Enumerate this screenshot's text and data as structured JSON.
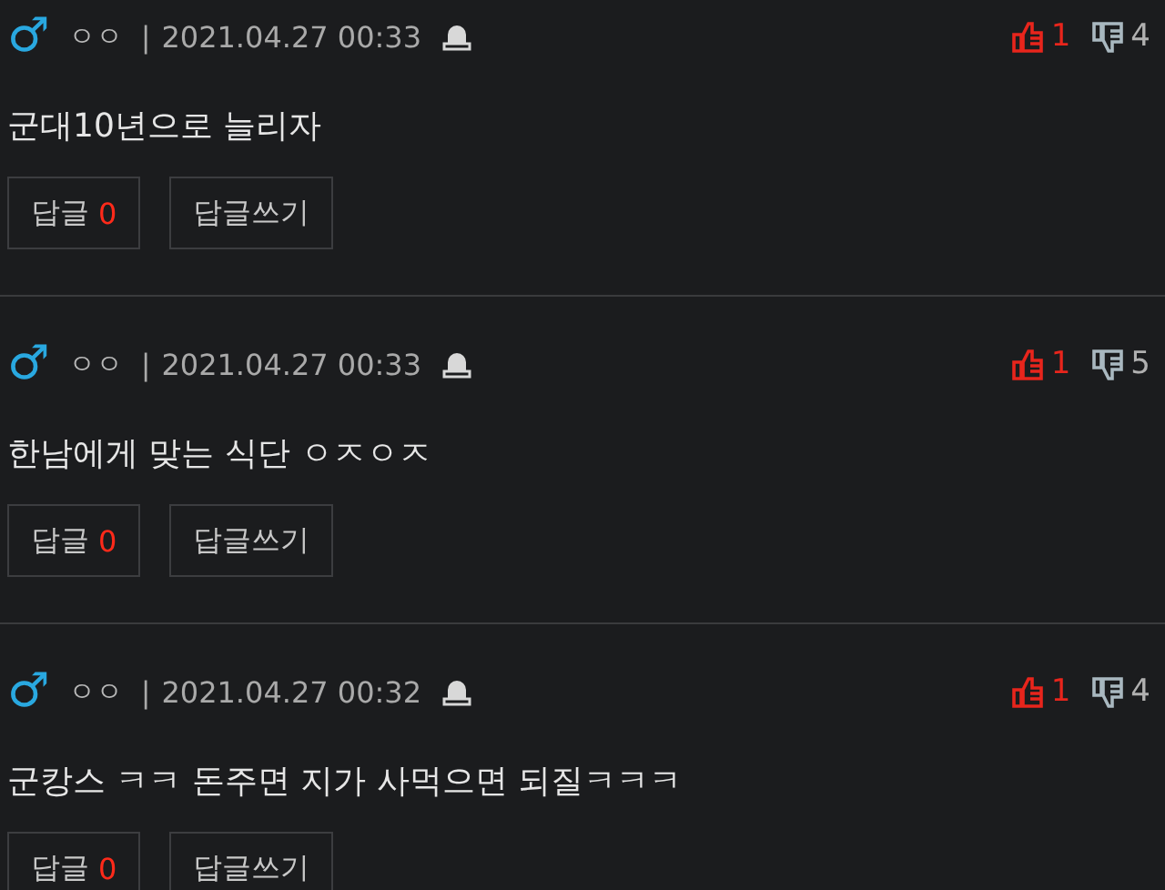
{
  "comments": [
    {
      "gender_symbol": "♂",
      "nickname": "ㅇㅇ",
      "separator": "|",
      "date": "2021.04.27 00:33",
      "likes": "1",
      "dislikes": "4",
      "text": "군대10년으로 늘리자",
      "reply_label": "답글",
      "reply_count": "0",
      "write_reply": "답글쓰기"
    },
    {
      "gender_symbol": "♂",
      "nickname": "ㅇㅇ",
      "separator": "|",
      "date": "2021.04.27 00:33",
      "likes": "1",
      "dislikes": "5",
      "text": "한남에게 맞는 식단 ㅇㅈㅇㅈ",
      "reply_label": "답글",
      "reply_count": "0",
      "write_reply": "답글쓰기"
    },
    {
      "gender_symbol": "♂",
      "nickname": "ㅇㅇ",
      "separator": "|",
      "date": "2021.04.27 00:32",
      "likes": "1",
      "dislikes": "4",
      "text": "군캉스 ㅋㅋ 돈주면 지가 사먹으면 되질ㅋㅋㅋ",
      "reply_label": "답글",
      "reply_count": "0",
      "write_reply": "답글쓰기"
    }
  ]
}
